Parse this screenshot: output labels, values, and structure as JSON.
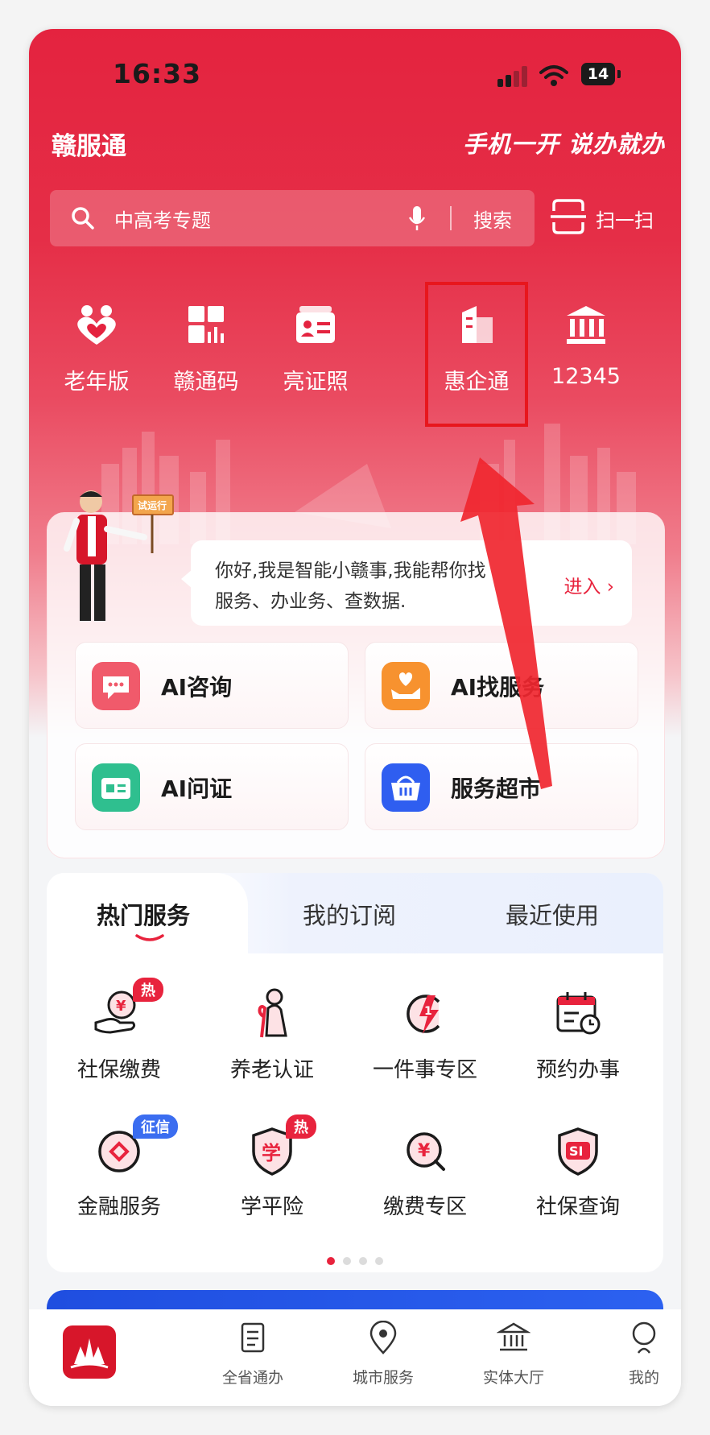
{
  "status_bar": {
    "time": "16:33",
    "battery": "14"
  },
  "header": {
    "brand": "赣服通",
    "slogan": "手机一开 说办就办"
  },
  "search": {
    "placeholder": "中高考专题",
    "button": "搜索",
    "scan_label": "扫一扫"
  },
  "quick_actions": [
    {
      "label": "老年版",
      "icon": "heart-hands-icon"
    },
    {
      "label": "赣通码",
      "icon": "qr-grid-icon"
    },
    {
      "label": "亮证照",
      "icon": "id-card-icon"
    },
    {
      "label": "惠企通",
      "icon": "building-icon"
    },
    {
      "label": "12345",
      "icon": "government-building-icon"
    }
  ],
  "assistant": {
    "sign": "试运行",
    "line1": "你好,我是智能小赣事,我能帮你找",
    "line2": "服务、办业务、查数据.",
    "enter": "进入 ›"
  },
  "ai_tiles": [
    {
      "label": "AI咨询",
      "icon": "chat-bubble-icon",
      "color": "#f05a6b"
    },
    {
      "label": "AI找服务",
      "icon": "heart-hand-icon",
      "color": "#f7922f"
    },
    {
      "label": "AI问证",
      "icon": "card-icon",
      "color": "#2fbf8f"
    },
    {
      "label": "服务超市",
      "icon": "basket-icon",
      "color": "#2f5ef0"
    }
  ],
  "service_tabs": [
    "热门服务",
    "我的订阅",
    "最近使用"
  ],
  "services": [
    {
      "label": "社保缴费",
      "icon": "money-hand-icon",
      "badge": "热"
    },
    {
      "label": "养老认证",
      "icon": "elderly-person-icon"
    },
    {
      "label": "一件事专区",
      "icon": "lightning-1-icon"
    },
    {
      "label": "预约办事",
      "icon": "calendar-clock-icon"
    },
    {
      "label": "金融服务",
      "icon": "coin-diamond-icon",
      "badge": "征信"
    },
    {
      "label": "学平险",
      "icon": "shield-xue-icon",
      "badge": "热"
    },
    {
      "label": "缴费专区",
      "icon": "yen-search-icon"
    },
    {
      "label": "社保查询",
      "icon": "shield-si-icon"
    }
  ],
  "pager": {
    "pages": 4,
    "current": 1
  },
  "tabbar": [
    {
      "label": "",
      "icon": "home-logo-icon"
    },
    {
      "label": "全省通办",
      "icon": "document-icon"
    },
    {
      "label": "城市服务",
      "icon": "location-pin-icon"
    },
    {
      "label": "实体大厅",
      "icon": "hall-icon"
    },
    {
      "label": "我的",
      "icon": "person-icon"
    }
  ],
  "colors": {
    "brand_red": "#e4233f",
    "accent_red": "#e8233d",
    "highlight_box": "#e8161d"
  }
}
